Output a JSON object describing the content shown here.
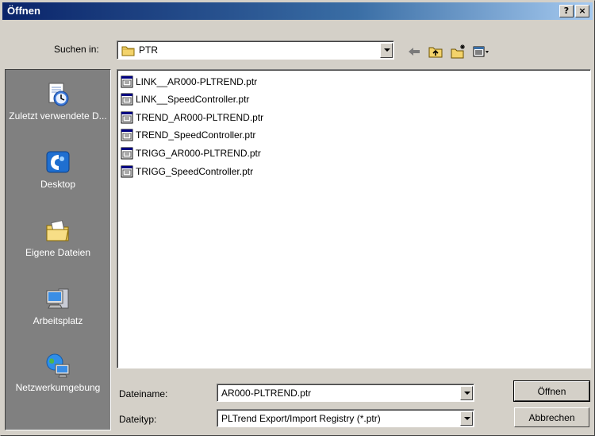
{
  "window": {
    "title": "Öffnen",
    "help_label": "?",
    "close_label": "×"
  },
  "lookin": {
    "label": "Suchen in:",
    "value": "PTR"
  },
  "places": [
    {
      "label": "Zuletzt verwendete D...",
      "icon": "recent-documents-icon"
    },
    {
      "label": "Desktop",
      "icon": "desktop-icon"
    },
    {
      "label": "Eigene Dateien",
      "icon": "my-documents-icon"
    },
    {
      "label": "Arbeitsplatz",
      "icon": "my-computer-icon"
    },
    {
      "label": "Netzwerkumgebung",
      "icon": "network-icon"
    }
  ],
  "files": [
    "LINK__AR000-PLTREND.ptr",
    "LINK__SpeedController.ptr",
    "TREND_AR000-PLTREND.ptr",
    "TREND_SpeedController.ptr",
    "TRIGG_AR000-PLTREND.ptr",
    "TRIGG_SpeedController.ptr"
  ],
  "filename": {
    "label": "Dateiname:",
    "value": "AR000-PLTREND.ptr"
  },
  "filetype": {
    "label": "Dateityp:",
    "value": "PLTrend Export/Import Registry (*.ptr)"
  },
  "buttons": {
    "open": "Öffnen",
    "cancel": "Abbrechen"
  }
}
